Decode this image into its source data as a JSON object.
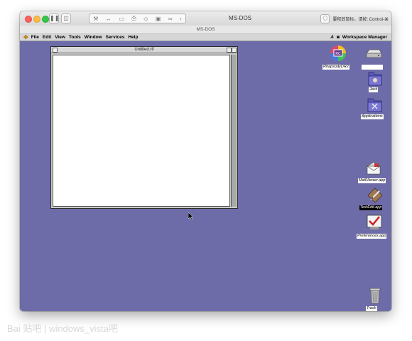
{
  "host": {
    "title": "MS-DOS",
    "tab_title": "MS-DOS",
    "hint_text": "要释放鼠标，请按: Control-⌘"
  },
  "menubar": {
    "items": [
      "File",
      "Edit",
      "View",
      "Tools",
      "Window",
      "Services",
      "Help"
    ],
    "workspace_label": "Workspace Manager"
  },
  "document": {
    "title": "Untitled.rtf"
  },
  "desktop_icons": {
    "rhapsody": "RhapsodyDR2",
    "drive": "",
    "jack": "Jack",
    "applications": "Applications",
    "mailviewer": "MailViewer.app",
    "textedit": "TextEdit.app",
    "preferences": "Preferences.app",
    "trash": "Trash"
  },
  "watermark": {
    "text": "Bai 贴吧 | windows_vista吧"
  }
}
